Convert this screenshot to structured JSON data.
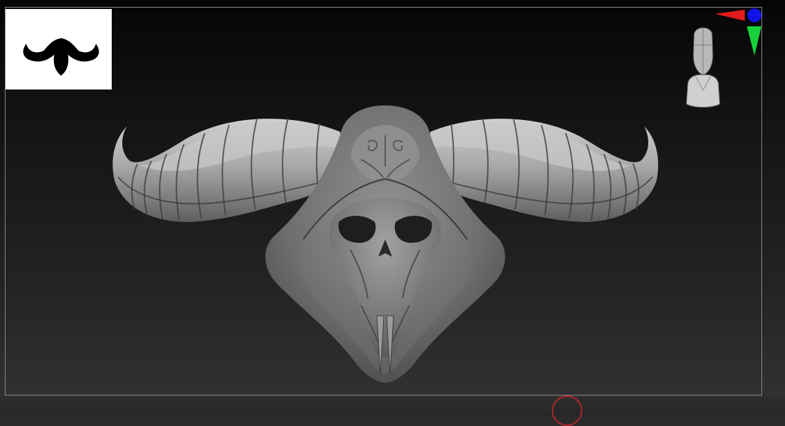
{
  "app": {
    "name": "ZBrush canvas",
    "colors": {
      "background_top": "#050505",
      "background_bottom": "#333333",
      "frame": "#8a8a8a",
      "axis_x": "#e31a1a",
      "axis_y": "#19d13c",
      "axis_z": "#1212e8",
      "cursor_ring": "#b3262b",
      "model_base": "#8c8c8c"
    }
  },
  "canvas": {
    "model": {
      "name": "horned-skull-mask",
      "material": "matcap-gray"
    }
  },
  "thumbnail": {
    "icon": "horned-head-silhouette-icon"
  },
  "navigator": {
    "icon": "head-orientation-icon"
  },
  "cursor": {
    "icon": "brush-cursor-ring"
  }
}
